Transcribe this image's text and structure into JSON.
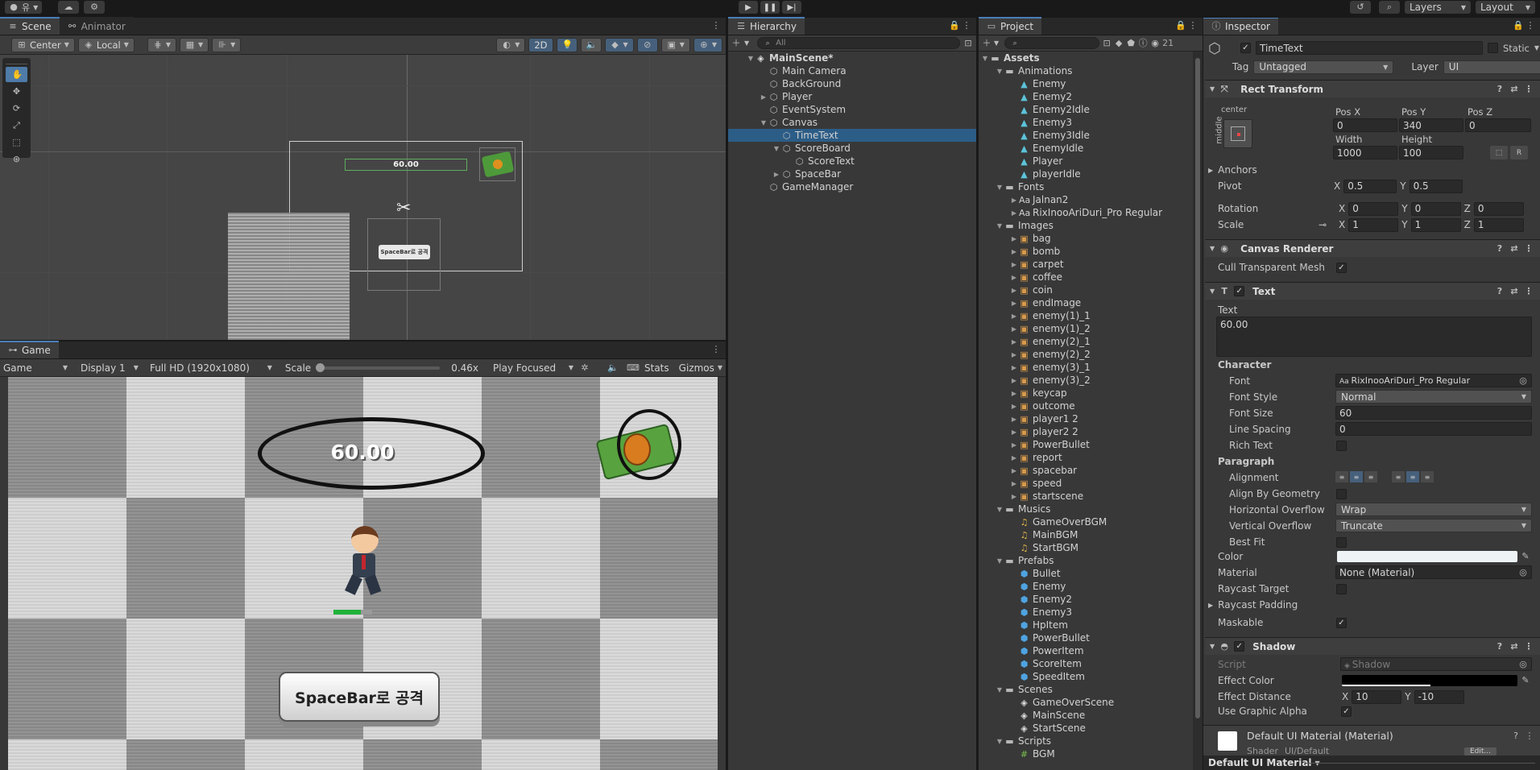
{
  "topbar": {
    "account_label": "유",
    "layers": "Layers",
    "layout": "Layout"
  },
  "scene": {
    "tabs": [
      "Scene",
      "Animator"
    ],
    "pivot": "Center",
    "space": "Local",
    "mode_2d": "2D",
    "timer_text": "60.00",
    "spacebar_text": "SpaceBar로 공격"
  },
  "game": {
    "tab": "Game",
    "dropdown_game": "Game",
    "display": "Display 1",
    "resolution": "Full HD (1920x1080)",
    "scale_label": "Scale",
    "scale_value": "0.46x",
    "play_mode": "Play Focused",
    "stats": "Stats",
    "gizmos": "Gizmos",
    "timer_text": "60.00",
    "spacebar_text": "SpaceBar로 공격"
  },
  "hierarchy": {
    "tab": "Hierarchy",
    "search_placeholder": "All",
    "items": [
      {
        "label": "MainScene*",
        "depth": 0,
        "arrow": "▼",
        "icon": "unity",
        "bold": true
      },
      {
        "label": "Main Camera",
        "depth": 1,
        "arrow": "",
        "icon": "cube"
      },
      {
        "label": "BackGround",
        "depth": 1,
        "arrow": "",
        "icon": "cube"
      },
      {
        "label": "Player",
        "depth": 1,
        "arrow": "▶",
        "icon": "cube"
      },
      {
        "label": "EventSystem",
        "depth": 1,
        "arrow": "",
        "icon": "cube"
      },
      {
        "label": "Canvas",
        "depth": 1,
        "arrow": "▼",
        "icon": "cube"
      },
      {
        "label": "TimeText",
        "depth": 2,
        "arrow": "",
        "icon": "cube",
        "selected": true
      },
      {
        "label": "ScoreBoard",
        "depth": 2,
        "arrow": "▼",
        "icon": "cube"
      },
      {
        "label": "ScoreText",
        "depth": 3,
        "arrow": "",
        "icon": "cube"
      },
      {
        "label": "SpaceBar",
        "depth": 2,
        "arrow": "▶",
        "icon": "cube"
      },
      {
        "label": "GameManager",
        "depth": 1,
        "arrow": "",
        "icon": "cube"
      }
    ]
  },
  "project": {
    "tab": "Project",
    "count": "21",
    "items": [
      {
        "label": "Assets",
        "depth": 0,
        "arrow": "▼",
        "icon": "folder",
        "bold": true
      },
      {
        "label": "Animations",
        "depth": 1,
        "arrow": "▼",
        "icon": "folder"
      },
      {
        "label": "Enemy",
        "depth": 2,
        "arrow": "",
        "icon": "anim"
      },
      {
        "label": "Enemy2",
        "depth": 2,
        "arrow": "",
        "icon": "anim"
      },
      {
        "label": "Enemy2Idle",
        "depth": 2,
        "arrow": "",
        "icon": "anim"
      },
      {
        "label": "Enemy3",
        "depth": 2,
        "arrow": "",
        "icon": "anim"
      },
      {
        "label": "Enemy3Idle",
        "depth": 2,
        "arrow": "",
        "icon": "anim"
      },
      {
        "label": "EnemyIdle",
        "depth": 2,
        "arrow": "",
        "icon": "anim"
      },
      {
        "label": "Player",
        "depth": 2,
        "arrow": "",
        "icon": "anim"
      },
      {
        "label": "playerIdle",
        "depth": 2,
        "arrow": "",
        "icon": "anim"
      },
      {
        "label": "Fonts",
        "depth": 1,
        "arrow": "▼",
        "icon": "folder"
      },
      {
        "label": "Jalnan2",
        "depth": 2,
        "arrow": "▶",
        "icon": "font"
      },
      {
        "label": "RixInooAriDuri_Pro Regular",
        "depth": 2,
        "arrow": "▶",
        "icon": "font"
      },
      {
        "label": "Images",
        "depth": 1,
        "arrow": "▼",
        "icon": "folder"
      },
      {
        "label": "bag",
        "depth": 2,
        "arrow": "▶",
        "icon": "img"
      },
      {
        "label": "bomb",
        "depth": 2,
        "arrow": "▶",
        "icon": "img"
      },
      {
        "label": "carpet",
        "depth": 2,
        "arrow": "▶",
        "icon": "img"
      },
      {
        "label": "coffee",
        "depth": 2,
        "arrow": "▶",
        "icon": "img"
      },
      {
        "label": "coin",
        "depth": 2,
        "arrow": "▶",
        "icon": "img"
      },
      {
        "label": "endImage",
        "depth": 2,
        "arrow": "▶",
        "icon": "img"
      },
      {
        "label": "enemy(1)_1",
        "depth": 2,
        "arrow": "▶",
        "icon": "img"
      },
      {
        "label": "enemy(1)_2",
        "depth": 2,
        "arrow": "▶",
        "icon": "img"
      },
      {
        "label": "enemy(2)_1",
        "depth": 2,
        "arrow": "▶",
        "icon": "img"
      },
      {
        "label": "enemy(2)_2",
        "depth": 2,
        "arrow": "▶",
        "icon": "img"
      },
      {
        "label": "enemy(3)_1",
        "depth": 2,
        "arrow": "▶",
        "icon": "img"
      },
      {
        "label": "enemy(3)_2",
        "depth": 2,
        "arrow": "▶",
        "icon": "img"
      },
      {
        "label": "keycap",
        "depth": 2,
        "arrow": "▶",
        "icon": "img"
      },
      {
        "label": "outcome",
        "depth": 2,
        "arrow": "▶",
        "icon": "img"
      },
      {
        "label": "player1 2",
        "depth": 2,
        "arrow": "▶",
        "icon": "img"
      },
      {
        "label": "player2 2",
        "depth": 2,
        "arrow": "▶",
        "icon": "img"
      },
      {
        "label": "PowerBullet",
        "depth": 2,
        "arrow": "▶",
        "icon": "img"
      },
      {
        "label": "report",
        "depth": 2,
        "arrow": "▶",
        "icon": "img"
      },
      {
        "label": "spacebar",
        "depth": 2,
        "arrow": "▶",
        "icon": "img"
      },
      {
        "label": "speed",
        "depth": 2,
        "arrow": "▶",
        "icon": "img"
      },
      {
        "label": "startscene",
        "depth": 2,
        "arrow": "▶",
        "icon": "img"
      },
      {
        "label": "Musics",
        "depth": 1,
        "arrow": "▼",
        "icon": "folder"
      },
      {
        "label": "GameOverBGM",
        "depth": 2,
        "arrow": "",
        "icon": "music"
      },
      {
        "label": "MainBGM",
        "depth": 2,
        "arrow": "",
        "icon": "music"
      },
      {
        "label": "StartBGM",
        "depth": 2,
        "arrow": "",
        "icon": "music"
      },
      {
        "label": "Prefabs",
        "depth": 1,
        "arrow": "▼",
        "icon": "folder"
      },
      {
        "label": "Bullet",
        "depth": 2,
        "arrow": "",
        "icon": "prefab"
      },
      {
        "label": "Enemy",
        "depth": 2,
        "arrow": "",
        "icon": "prefab"
      },
      {
        "label": "Enemy2",
        "depth": 2,
        "arrow": "",
        "icon": "prefab"
      },
      {
        "label": "Enemy3",
        "depth": 2,
        "arrow": "",
        "icon": "prefab"
      },
      {
        "label": "HpItem",
        "depth": 2,
        "arrow": "",
        "icon": "prefab"
      },
      {
        "label": "PowerBullet",
        "depth": 2,
        "arrow": "",
        "icon": "prefab"
      },
      {
        "label": "PowerItem",
        "depth": 2,
        "arrow": "",
        "icon": "prefab"
      },
      {
        "label": "ScoreItem",
        "depth": 2,
        "arrow": "",
        "icon": "prefab"
      },
      {
        "label": "SpeedItem",
        "depth": 2,
        "arrow": "",
        "icon": "prefab"
      },
      {
        "label": "Scenes",
        "depth": 1,
        "arrow": "▼",
        "icon": "folder"
      },
      {
        "label": "GameOverScene",
        "depth": 2,
        "arrow": "",
        "icon": "unity"
      },
      {
        "label": "MainScene",
        "depth": 2,
        "arrow": "",
        "icon": "unity"
      },
      {
        "label": "StartScene",
        "depth": 2,
        "arrow": "",
        "icon": "unity"
      },
      {
        "label": "Scripts",
        "depth": 1,
        "arrow": "▼",
        "icon": "folder"
      },
      {
        "label": "BGM",
        "depth": 2,
        "arrow": "",
        "icon": "script"
      }
    ]
  },
  "inspector": {
    "tab": "Inspector",
    "object_name": "TimeText",
    "static": "Static",
    "tag_label": "Tag",
    "tag": "Untagged",
    "layer_label": "Layer",
    "layer": "UI",
    "rect": {
      "title": "Rect Transform",
      "anchor_h": "center",
      "anchor_v": "middle",
      "posx_l": "Pos X",
      "posy_l": "Pos Y",
      "posz_l": "Pos Z",
      "posx": "0",
      "posy": "340",
      "posz": "0",
      "width_l": "Width",
      "height_l": "Height",
      "width": "1000",
      "height": "100",
      "anchors": "Anchors",
      "pivot": "Pivot",
      "pivot_x": "0.5",
      "pivot_y": "0.5",
      "rotation": "Rotation",
      "rot_x": "0",
      "rot_y": "0",
      "rot_z": "0",
      "scale": "Scale",
      "scale_x": "1",
      "scale_y": "1",
      "scale_z": "1",
      "x": "X",
      "y": "Y",
      "z": "Z"
    },
    "canvas_renderer": {
      "title": "Canvas Renderer",
      "cull": "Cull Transparent Mesh"
    },
    "text": {
      "title": "Text",
      "text_label": "Text",
      "value": "60.00",
      "character": "Character",
      "font_l": "Font",
      "font": "RixInooAriDuri_Pro Regular",
      "font_style_l": "Font Style",
      "font_style": "Normal",
      "font_size_l": "Font Size",
      "font_size": "60",
      "line_spacing_l": "Line Spacing",
      "line_spacing": "0",
      "rich_text": "Rich Text",
      "paragraph": "Paragraph",
      "alignment": "Alignment",
      "align_geo": "Align By Geometry",
      "h_overflow_l": "Horizontal Overflow",
      "h_overflow": "Wrap",
      "v_overflow_l": "Vertical Overflow",
      "v_overflow": "Truncate",
      "best_fit": "Best Fit",
      "color": "Color",
      "material_l": "Material",
      "material": "None (Material)",
      "raycast_target": "Raycast Target",
      "raycast_padding": "Raycast Padding",
      "maskable": "Maskable"
    },
    "shadow": {
      "title": "Shadow",
      "script_l": "Script",
      "script": "Shadow",
      "effect_color": "Effect Color",
      "effect_distance": "Effect Distance",
      "dist_x": "10",
      "dist_y": "-10",
      "use_graphic_alpha": "Use Graphic Alpha"
    },
    "material_footer": "Default UI Material (Material)",
    "shader_l": "Shader",
    "shader": "UI/Default",
    "edit": "Edit...",
    "bottom_label": "Default UI Material"
  },
  "colors": {
    "accent": "#2c5d87",
    "panel": "#383838",
    "header": "#282828",
    "bg": "#191919"
  }
}
